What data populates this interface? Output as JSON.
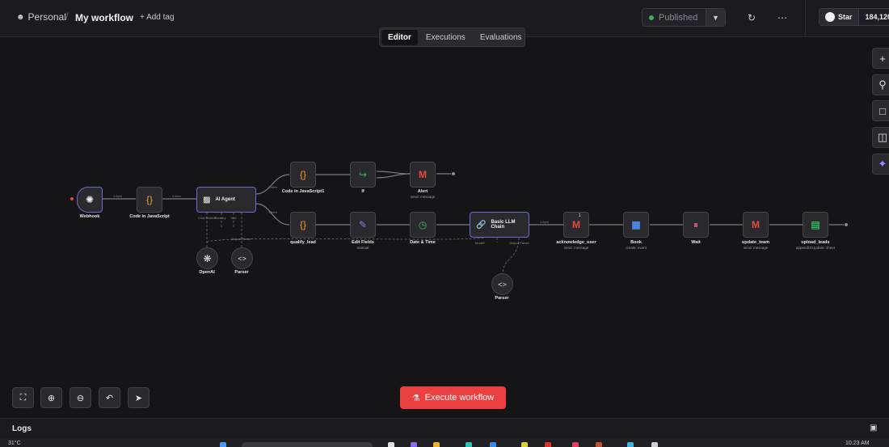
{
  "header": {
    "breadcrumb_personal": "Personal",
    "breadcrumb_sep": "/",
    "workflow_title": "My workflow",
    "add_tag": "+ Add tag",
    "published_label": "Published",
    "github_star": "Star",
    "github_count": "184,120"
  },
  "tabs": [
    {
      "label": "Editor",
      "active": true
    },
    {
      "label": "Executions",
      "active": false
    },
    {
      "label": "Evaluations",
      "active": false
    }
  ],
  "nodes": {
    "webhook": {
      "label": "Webhook"
    },
    "code1": {
      "label": "Code in JavaScript"
    },
    "agent": {
      "label": "AI Agent"
    },
    "code2": {
      "label": "Code in JavaScript1"
    },
    "if": {
      "label": "If"
    },
    "alert": {
      "label": "Alert",
      "sub": "send: message"
    },
    "qualify": {
      "label": "qualify_lead"
    },
    "editfields": {
      "label": "Edit Fields",
      "sub": "manual"
    },
    "datetime": {
      "label": "Date & Time"
    },
    "llmchain": {
      "label": "Basic LLM Chain"
    },
    "ack": {
      "label": "acknowledge_user",
      "sub": "send: message",
      "badge": "1"
    },
    "book": {
      "label": "Book",
      "sub": "create: event"
    },
    "wait": {
      "label": "Wait"
    },
    "update": {
      "label": "update_team",
      "sub": "send: message"
    },
    "upload": {
      "label": "upload_leads",
      "sub": "appendOrUpdate: sheet"
    },
    "openai": {
      "label": "OpenAI"
    },
    "parser1": {
      "label": "Parser"
    },
    "parser2": {
      "label": "Parser"
    }
  },
  "ports": {
    "agent_model": "Chat Model*",
    "agent_memory": "Memory",
    "agent_tool": "Tool",
    "agent_parser": "Output Parser",
    "chain_model": "Model*",
    "chain_parser": "Output Parser"
  },
  "edge_labels": {
    "webhook_code": "1 item",
    "code_agent": "1 item",
    "agent_top": "1 item",
    "agent_bottom": "1 item",
    "chain_ack": "1 item"
  },
  "execute_button": "Execute workflow",
  "logs_title": "Logs",
  "taskbar": {
    "temperature": "31°C",
    "time": "10:23 AM"
  },
  "colors": {
    "accent": "#eb4040",
    "published_dot": "#3fae5e",
    "agent_border": "#6b6bd6"
  }
}
